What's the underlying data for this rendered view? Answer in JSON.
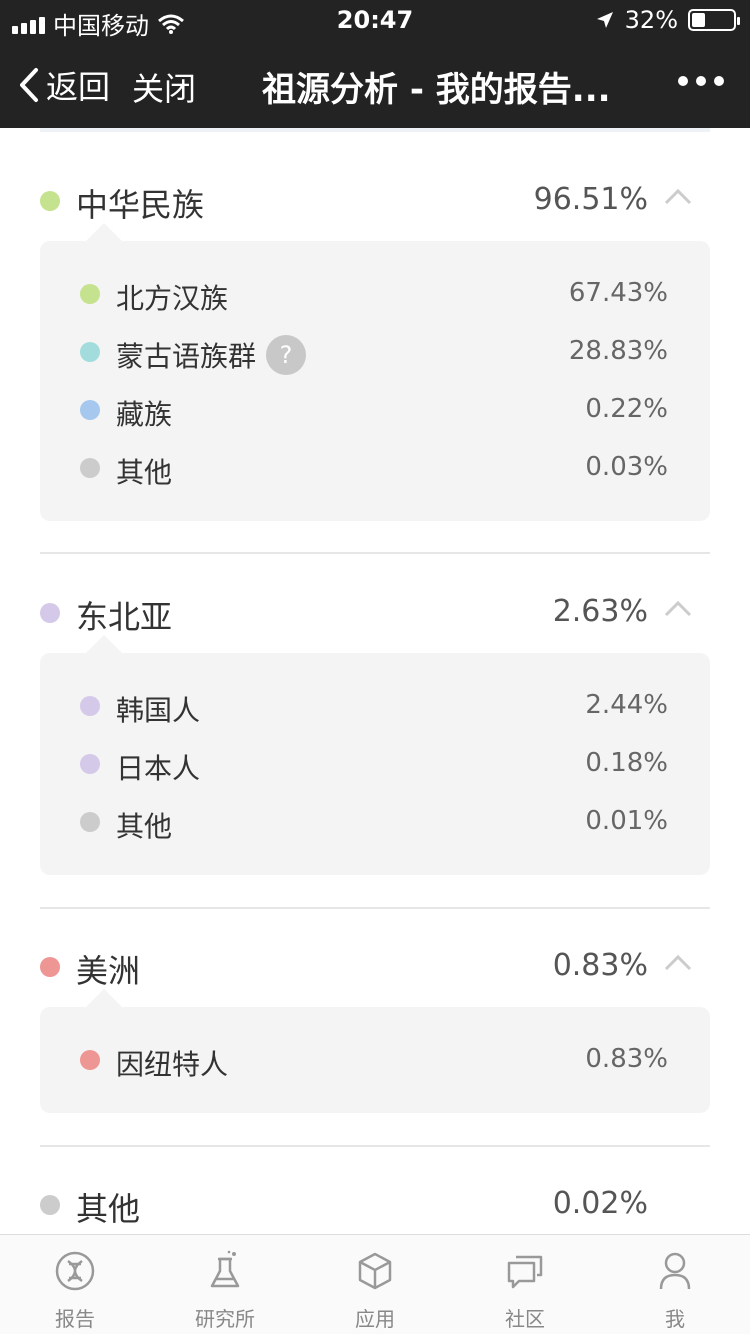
{
  "status": {
    "carrier": "中国移动",
    "time": "20:47",
    "battery_text": "32%",
    "battery_level": 0.32
  },
  "nav": {
    "back_label": "返回",
    "close_label": "关闭",
    "title": "祖源分析 - 我的报告..."
  },
  "sections": [
    {
      "name": "中华民族",
      "percent": "96.51%",
      "color": "#c5e28e",
      "items": [
        {
          "name": "北方汉族",
          "percent": "67.43%",
          "color": "#c5e28e"
        },
        {
          "name": "蒙古语族群",
          "percent": "28.83%",
          "color": "#a3dcdc",
          "help": "?"
        },
        {
          "name": "藏族",
          "percent": "0.22%",
          "color": "#a6c8ee"
        },
        {
          "name": "其他",
          "percent": "0.03%",
          "color": "#cccccc"
        }
      ]
    },
    {
      "name": "东北亚",
      "percent": "2.63%",
      "color": "#d5c9ea",
      "items": [
        {
          "name": "韩国人",
          "percent": "2.44%",
          "color": "#d5c9ea"
        },
        {
          "name": "日本人",
          "percent": "0.18%",
          "color": "#d5c9ea"
        },
        {
          "name": "其他",
          "percent": "0.01%",
          "color": "#cccccc"
        }
      ]
    },
    {
      "name": "美洲",
      "percent": "0.83%",
      "color": "#ee9693",
      "items": [
        {
          "name": "因纽特人",
          "percent": "0.83%",
          "color": "#ee9693"
        }
      ]
    },
    {
      "name": "其他",
      "percent": "0.02%",
      "color": "#cccccc",
      "items": []
    }
  ],
  "tabs": [
    {
      "label": "报告",
      "icon": "dna-icon"
    },
    {
      "label": "研究所",
      "icon": "flask-icon"
    },
    {
      "label": "应用",
      "icon": "cube-icon"
    },
    {
      "label": "社区",
      "icon": "chat-icon"
    },
    {
      "label": "我",
      "icon": "person-icon"
    }
  ]
}
